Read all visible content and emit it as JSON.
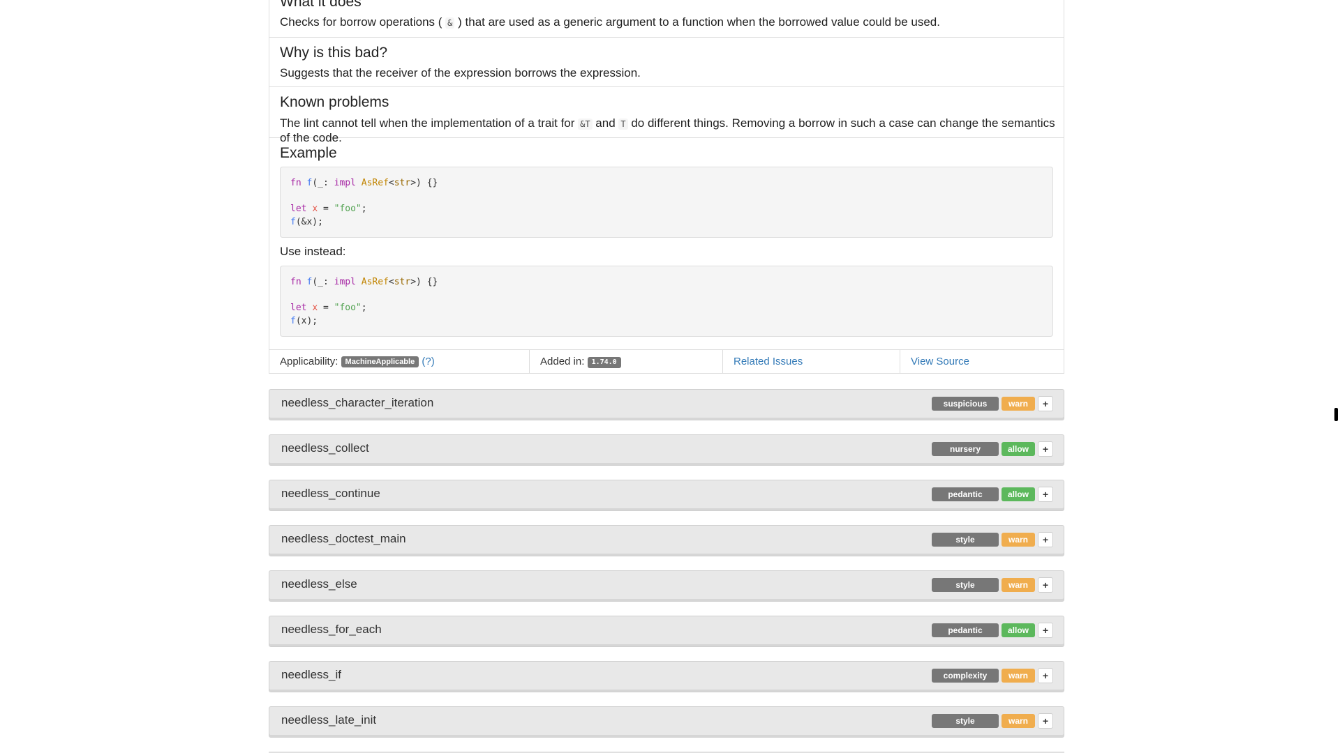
{
  "expanded_lint": {
    "what_it_does": {
      "heading": "What it does",
      "text_before": "Checks for borrow operations (",
      "code": "&",
      "text_after": ") that are used as a generic argument to a function when the borrowed value could be used."
    },
    "why_bad": {
      "heading": "Why is this bad?",
      "text": "Suggests that the receiver of the expression borrows the expression."
    },
    "known_problems": {
      "heading": "Known problems",
      "text_1": "The lint cannot tell when the implementation of a trait for ",
      "code_1": "&T",
      "text_2": " and ",
      "code_2": "T",
      "text_3": " do different things. Removing a borrow in such a case can change the semantics of the code."
    },
    "example": {
      "heading": "Example",
      "code1": {
        "line1": {
          "kw_fn": "fn",
          "fname": "f",
          "p1": "(_: ",
          "kw_impl": "impl",
          "trait": "AsRef",
          "lt": "<",
          "ty": "str",
          "rest": ">) {}"
        },
        "line3": {
          "kw_let": "let",
          "var": "x",
          "eq": " = ",
          "str": "\"foo\"",
          "semi": ";"
        },
        "line4": {
          "fname": "f",
          "args": "(&x);"
        }
      },
      "use_instead": "Use instead:",
      "code2": {
        "line1": {
          "kw_fn": "fn",
          "fname": "f",
          "p1": "(_: ",
          "kw_impl": "impl",
          "trait": "AsRef",
          "lt": "<",
          "ty": "str",
          "rest": ">) {}"
        },
        "line3": {
          "kw_let": "let",
          "var": "x",
          "eq": " = ",
          "str": "\"foo\"",
          "semi": ";"
        },
        "line4": {
          "fname": "f",
          "args": "(x);"
        }
      }
    },
    "meta": {
      "applicability_label": "Applicability:",
      "applicability_value": "MachineApplicable",
      "applicability_help": "(?)",
      "added_in_label": "Added in:",
      "added_in_value": "1.74.0",
      "related_issues": "Related Issues",
      "view_source": "View Source"
    }
  },
  "lints": [
    {
      "name": "needless_character_iteration",
      "group": "suspicious",
      "level": "warn",
      "expand": "+"
    },
    {
      "name": "needless_collect",
      "group": "nursery",
      "level": "allow",
      "expand": "+"
    },
    {
      "name": "needless_continue",
      "group": "pedantic",
      "level": "allow",
      "expand": "+"
    },
    {
      "name": "needless_doctest_main",
      "group": "style",
      "level": "warn",
      "expand": "+"
    },
    {
      "name": "needless_else",
      "group": "style",
      "level": "warn",
      "expand": "+"
    },
    {
      "name": "needless_for_each",
      "group": "pedantic",
      "level": "allow",
      "expand": "+"
    },
    {
      "name": "needless_if",
      "group": "complexity",
      "level": "warn",
      "expand": "+"
    },
    {
      "name": "needless_late_init",
      "group": "style",
      "level": "warn",
      "expand": "+"
    }
  ],
  "colors": {
    "group_badge": "#777777",
    "warn": "#f0ad4e",
    "allow": "#5cb85c",
    "link": "#337ab7"
  }
}
